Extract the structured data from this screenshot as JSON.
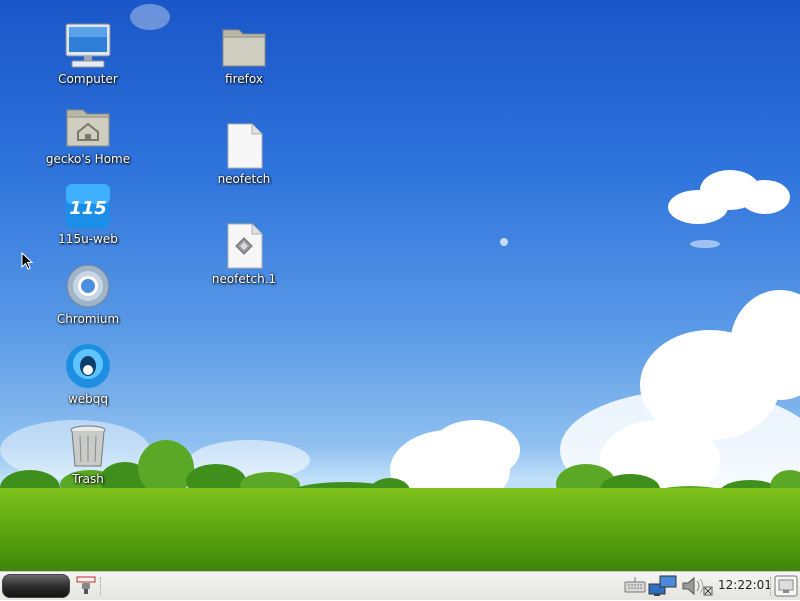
{
  "desktop": {
    "icons": [
      {
        "label": "Computer",
        "icon": "computer-icon"
      },
      {
        "label": "gecko's Home",
        "icon": "home-folder-icon"
      },
      {
        "label": "115u-web",
        "icon": "app-115-icon",
        "badge_text": "115"
      },
      {
        "label": "Chromium",
        "icon": "chromium-icon"
      },
      {
        "label": "webqq",
        "icon": "webqq-icon"
      },
      {
        "label": "Trash",
        "icon": "trash-icon"
      },
      {
        "label": "firefox",
        "icon": "folder-icon"
      },
      {
        "label": "neofetch",
        "icon": "text-file-icon"
      },
      {
        "label": "neofetch.1",
        "icon": "manpage-file-icon"
      }
    ]
  },
  "taskbar": {
    "clock": "12:22:01",
    "tray_icons": [
      "keyboard-icon",
      "network-icon",
      "volume-muted-icon",
      "show-desktop-icon"
    ]
  },
  "colors": {
    "sky_top": "#1a56c8",
    "sky_bottom": "#bfe0f8",
    "grass": "#6cb214",
    "taskbar": "#e8e8e4"
  }
}
